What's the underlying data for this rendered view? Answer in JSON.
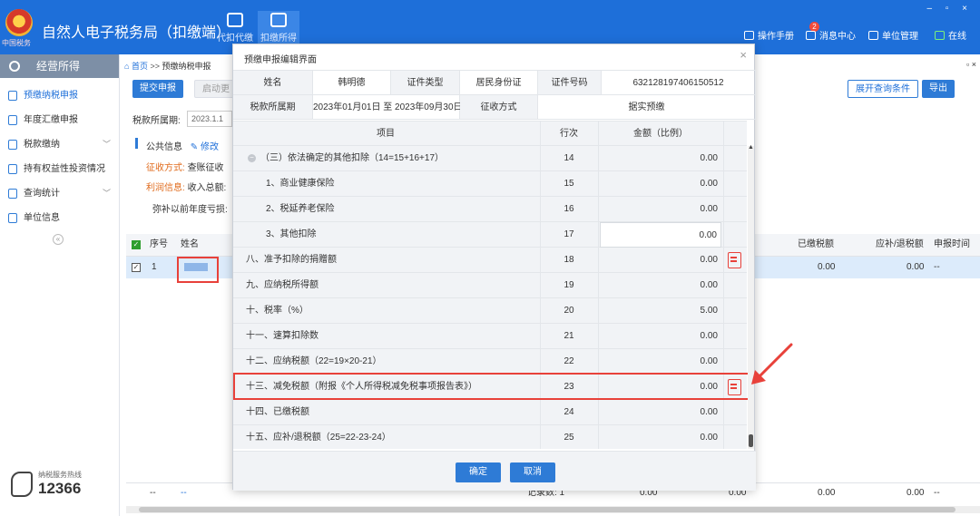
{
  "app": {
    "title": "自然人电子税务局（扣缴端）",
    "emblem_sub": "中国税务",
    "top_tabs": [
      {
        "label": "代扣代缴"
      },
      {
        "label": "扣缴所得"
      }
    ],
    "tools": {
      "manual": "操作手册",
      "messages": "消息中心",
      "messages_badge": "2",
      "unit": "单位管理",
      "online": "在线"
    },
    "window_controls": "– ▫ ×"
  },
  "sidebar": {
    "head": "经营所得",
    "items": [
      {
        "label": "预缴纳税申报",
        "chev": ""
      },
      {
        "label": "年度汇缴申报",
        "chev": ""
      },
      {
        "label": "税款缴纳",
        "chev": "﹀"
      },
      {
        "label": "持有权益性投资情况",
        "chev": ""
      },
      {
        "label": "查询统计",
        "chev": "﹀"
      },
      {
        "label": "单位信息",
        "chev": ""
      }
    ],
    "collapse": "«",
    "hotline_label": "纳税服务热线",
    "hotline_number": "12366"
  },
  "main": {
    "breadcrumb_home": "首页",
    "breadcrumb_sep": ">>",
    "breadcrumb_page": "预缴纳税申报",
    "breadcrumb_ctl": "▫ ×",
    "submit_btn": "提交申报",
    "start_btn": "启动更",
    "expand_btn": "展开查询条件",
    "export_btn": "导出",
    "period_label": "税款所属期:",
    "period_value": "2023.1.1",
    "public_info": "公共信息",
    "edit_link": "修改",
    "collect_label": "征收方式:",
    "collect_value": "查账征收",
    "profit_label": "利润信息:",
    "profit_value": "收入总额:",
    "loss_text": "弥补以前年度亏损:",
    "table": {
      "col_seq": "序号",
      "col_name": "姓名",
      "col_paid": "已缴税额",
      "col_refund": "应补/退税额",
      "col_time": "申报时间",
      "row_seq": "1",
      "row_paid": "0.00",
      "row_refund": "0.00",
      "row_time": "--"
    },
    "footer": {
      "c1": "--",
      "c2": "--",
      "records": "记录数: 1",
      "v1": "0.00",
      "v2": "0.00",
      "v3": "0.00",
      "v4": "0.00",
      "v5": "--"
    }
  },
  "dialog": {
    "title": "预缴申报编辑界面",
    "close": "×",
    "info": {
      "name_label": "姓名",
      "name_value": "韩明德",
      "idtype_label": "证件类型",
      "idtype_value": "居民身份证",
      "idno_label": "证件号码",
      "idno_value": "632128197406150512",
      "period_label": "税款所属期",
      "period_value": "2023年01月01日 至 2023年09月30日",
      "method_label": "征收方式",
      "method_value": "据实预缴"
    },
    "columns": {
      "item": "项目",
      "line": "行次",
      "amount": "金额（比例）"
    },
    "rows": [
      {
        "name": "（三）依法确定的其他扣除（14=15+16+17）",
        "line": "14",
        "amount": "0.00"
      },
      {
        "name": "1、商业健康保险",
        "line": "15",
        "amount": "0.00"
      },
      {
        "name": "2、税延养老保险",
        "line": "16",
        "amount": "0.00"
      },
      {
        "name": "3、其他扣除",
        "line": "17",
        "amount": "0.00"
      },
      {
        "name": "八、准予扣除的捐赠额",
        "line": "18",
        "amount": "0.00"
      },
      {
        "name": "九、应纳税所得额",
        "line": "19",
        "amount": "0.00"
      },
      {
        "name": "十、税率（%）",
        "line": "20",
        "amount": "5.00"
      },
      {
        "name": "十一、速算扣除数",
        "line": "21",
        "amount": "0.00"
      },
      {
        "name": "十二、应纳税额（22=19×20-21）",
        "line": "22",
        "amount": "0.00"
      },
      {
        "name": "十三、减免税额（附报《个人所得税减免税事项报告表》）",
        "line": "23",
        "amount": "0.00"
      },
      {
        "name": "十四、已缴税额",
        "line": "24",
        "amount": "0.00"
      },
      {
        "name": "十五、应补/退税额（25=22-23-24）",
        "line": "25",
        "amount": "0.00"
      }
    ],
    "expand_icon": "−",
    "ok_btn": "确定",
    "cancel_btn": "取消"
  },
  "colors": {
    "primary": "#1e6fd9",
    "highlight": "#e8413a"
  }
}
